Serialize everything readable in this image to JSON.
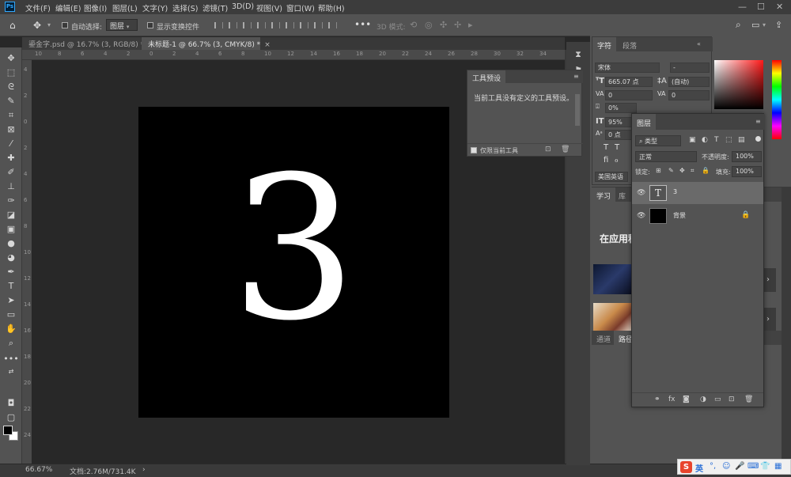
{
  "menubar": {
    "logo": "Ps",
    "items": [
      "文件(F)",
      "编辑(E)",
      "图像(I)",
      "图层(L)",
      "文字(Y)",
      "选择(S)",
      "滤镜(T)",
      "3D(D)",
      "视图(V)",
      "窗口(W)",
      "帮助(H)"
    ],
    "window_controls": [
      "—",
      "☐",
      "✕"
    ]
  },
  "options": {
    "auto_select_label": "自动选择:",
    "layer_value": "图层",
    "show_transform_label": "显示变换控件",
    "mode_3d_label": "3D 模式:"
  },
  "tabs": [
    {
      "label": "鎏金字.psd @ 16.7% (3, RGB/8) *",
      "close": "×"
    },
    {
      "label": "未标题-1 @ 66.7% (3, CMYK/8) *",
      "close": "×"
    }
  ],
  "ruler": {
    "top_ticks": [
      "10",
      "8",
      "6",
      "4",
      "2",
      "0",
      "2",
      "4",
      "6",
      "8",
      "10",
      "12",
      "14",
      "16",
      "18",
      "20",
      "22",
      "24",
      "26",
      "28",
      "30",
      "32",
      "34"
    ],
    "left_ticks": [
      "4",
      "2",
      "0",
      "2",
      "4",
      "6",
      "8",
      "10",
      "12",
      "14",
      "16",
      "18",
      "20",
      "22",
      "24"
    ]
  },
  "canvas": {
    "digit": "3"
  },
  "status": {
    "zoom": "66.67%",
    "doc_info": "文档:2.76M/731.4K",
    "arrow": "›"
  },
  "presets_panel": {
    "title": "工具预设",
    "message": "当前工具没有定义的工具预设。",
    "footer_label": "仅限当前工具"
  },
  "char_panel": {
    "tab_char": "字符",
    "tab_para": "段落",
    "font_family": "宋体",
    "font_style": "-",
    "size": "665.07 点",
    "leading": "(自动)",
    "kerning": "0",
    "tracking": "0",
    "scale_v": "0%",
    "scale_h": "95%",
    "baseline": "0 点",
    "language": "美国英语"
  },
  "learn_panel": {
    "tab_learn": "学习",
    "tab_lib": "库",
    "heading": "在应用程",
    "tab_channels": "通道",
    "tab_paths": "路径"
  },
  "layers_panel": {
    "title": "图层",
    "filter_kind": "类型",
    "blend_mode": "正常",
    "opacity_label": "不透明度:",
    "opacity": "100%",
    "lock_label": "锁定:",
    "fill_label": "填充:",
    "fill": "100%",
    "layers": [
      {
        "name": "3",
        "type": "text",
        "thumb": "T"
      },
      {
        "name": "背景",
        "type": "background"
      }
    ]
  },
  "taskbar": {
    "ime_logo": "S",
    "ime_lang": "英"
  },
  "colors": {
    "ui_dark": "#282828",
    "panel": "#535353",
    "accent_blue": "#31a8ff"
  }
}
